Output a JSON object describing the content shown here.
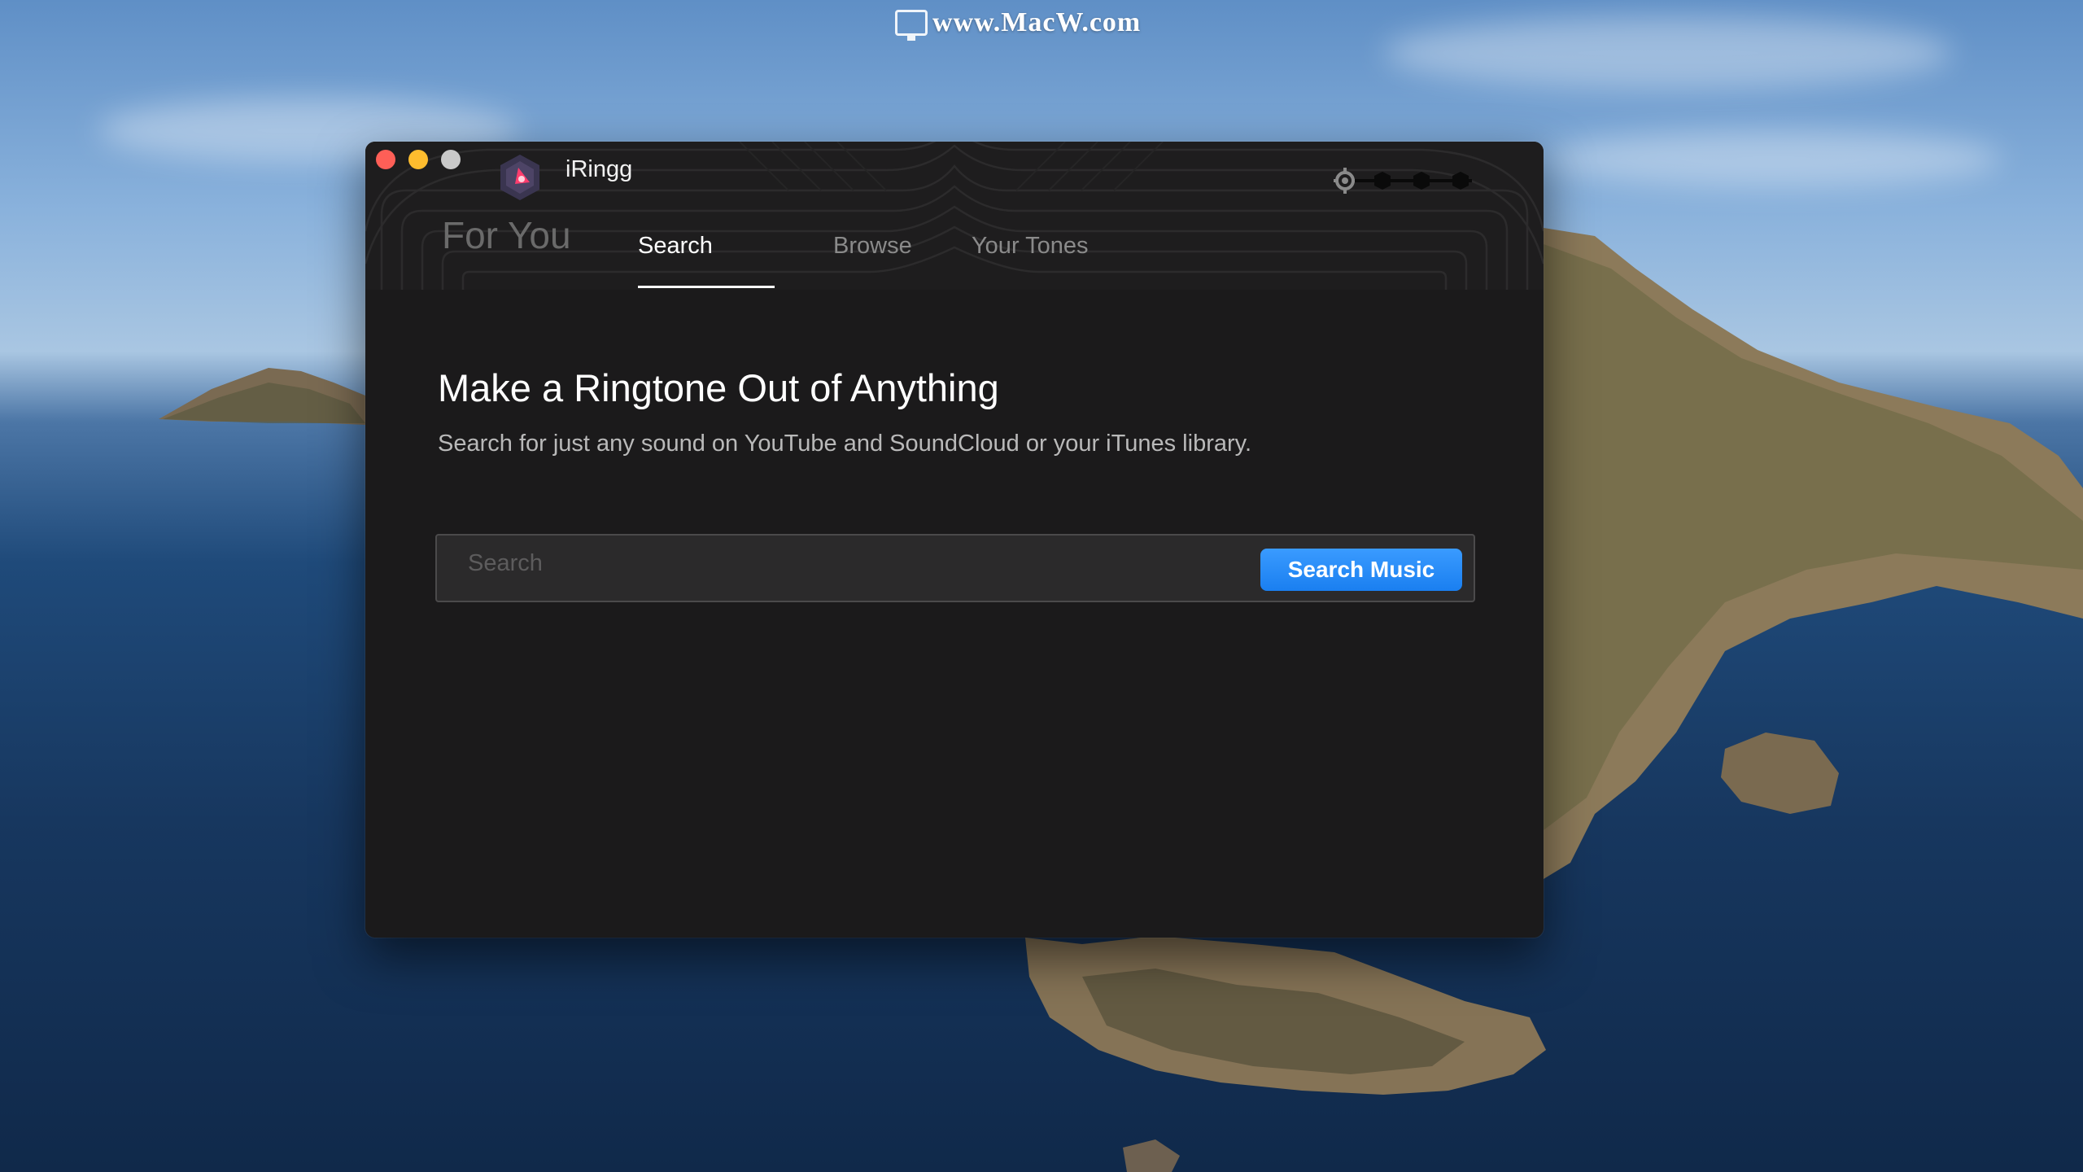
{
  "watermark": {
    "text": "www.MacW.com",
    "icon": "monitor-icon"
  },
  "window": {
    "title": "iRingg",
    "logo_icon": "iringg-logo-icon",
    "controls": {
      "close_color": "#fe5f57",
      "minimize_color": "#febc2e",
      "maximize_color": "#c9c9c9"
    },
    "header_tools_icon": "settings-slider-icon"
  },
  "tabs": {
    "for_you": "For You",
    "items": [
      {
        "label": "Search",
        "active": true
      },
      {
        "label": "Browse",
        "active": false
      },
      {
        "label": "Your Tones",
        "active": false
      }
    ]
  },
  "main": {
    "headline": "Make a Ringtone Out of Anything",
    "subline": "Search for just any sound on YouTube and SoundCloud or your iTunes library.",
    "search": {
      "placeholder": "Search",
      "value": "",
      "button_label": "Search Music",
      "button_color": "#1a7ff0"
    }
  }
}
